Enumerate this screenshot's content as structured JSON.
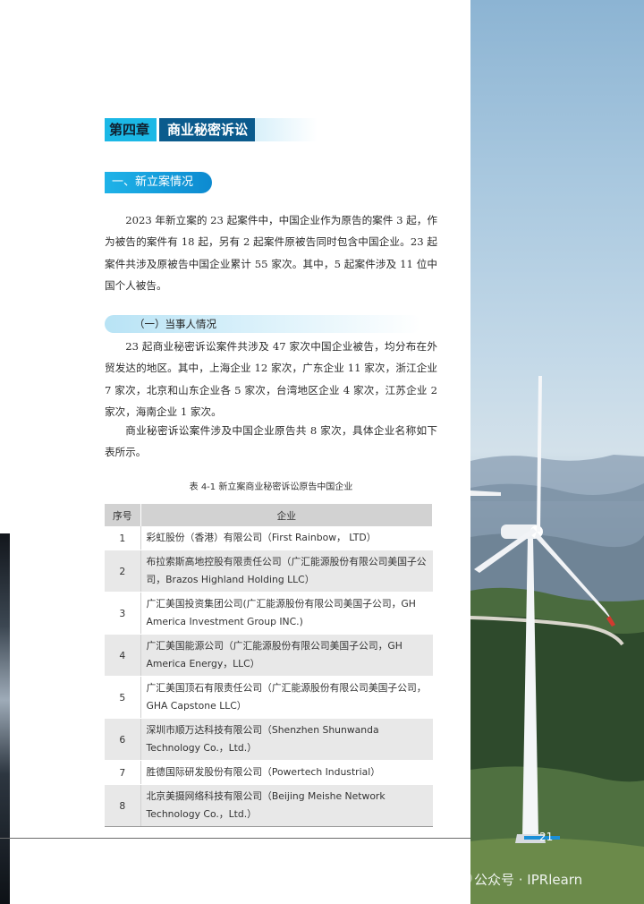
{
  "chapter": {
    "number": "第四章",
    "title": "商业秘密诉讼"
  },
  "section1": {
    "title": "一、新立案情况"
  },
  "paragraph1": "2023 年新立案的 23 起案件中，中国企业作为原告的案件 3 起，作为被告的案件有 18 起，另有 2 起案件原被告同时包含中国企业。23 起案件共涉及原被告中国企业累计 55 家次。其中，5 起案件涉及 11 位中国个人被告。",
  "subsection1": {
    "title": "（一）当事人情况"
  },
  "paragraph2": "23 起商业秘密诉讼案件共涉及 47 家次中国企业被告，均分布在外贸发达的地区。其中，上海企业 12 家次，广东企业 11 家次，浙江企业 7 家次，北京和山东企业各 5 家次，台湾地区企业 4 家次，江苏企业 2 家次，海南企业 1 家次。",
  "paragraph3": "商业秘密诉讼案件涉及中国企业原告共 8 家次，具体企业名称如下表所示。",
  "table": {
    "caption": "表 4-1  新立案商业秘密诉讼原告中国企业",
    "headers": [
      "序号",
      "企业"
    ],
    "rows": [
      {
        "index": "1",
        "company": "彩虹股份（香港）有限公司（First Rainbow， LTD）"
      },
      {
        "index": "2",
        "company": "布拉索斯高地控股有限责任公司（广汇能源股份有限公司美国子公司，Brazos Highland Holding LLC）"
      },
      {
        "index": "3",
        "company": "广汇美国投资集团公司(广汇能源股份有限公司美国子公司，GH America Investment Group INC.)"
      },
      {
        "index": "4",
        "company": "广汇美国能源公司（广汇能源股份有限公司美国子公司，GH America Energy，LLC）"
      },
      {
        "index": "5",
        "company": "广汇美国顶石有限责任公司（广汇能源股份有限公司美国子公司，GHA Capstone LLC）"
      },
      {
        "index": "6",
        "company": "深圳市顺万达科技有限公司（Shenzhen Shunwanda Technology Co.，Ltd.）"
      },
      {
        "index": "7",
        "company": "胜德国际研发股份有限公司（Powertech Industrial）"
      },
      {
        "index": "8",
        "company": "北京美摄网络科技有限公司（Beijing Meishe Network Technology Co.，Ltd.）"
      }
    ]
  },
  "page_number": "21",
  "watermark": "公众号 · IPRlearn",
  "colors": {
    "accent": "#1bb8e6",
    "dark_accent": "#0b5b8d",
    "table_header": "#d2d2d2",
    "table_stripe": "#e8e8e8"
  }
}
